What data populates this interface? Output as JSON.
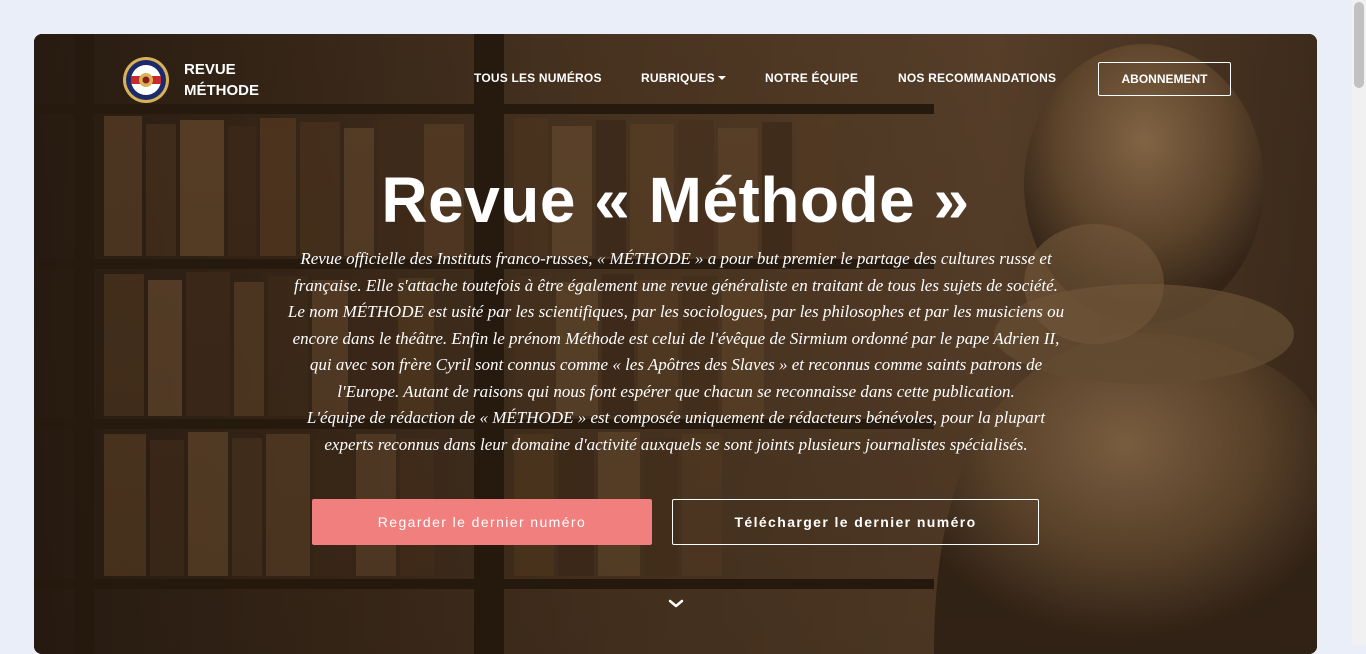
{
  "brand": {
    "name_line1": "REVUE",
    "name_line2": "MÉTHODE"
  },
  "nav": {
    "items": [
      {
        "label": "TOUS LES NUMÉROS"
      },
      {
        "label": "RUBRIQUES",
        "has_dropdown": true
      },
      {
        "label": "NOTRE ÉQUIPE"
      },
      {
        "label": "NOS RECOMMANDATIONS"
      }
    ],
    "subscribe_label": "ABONNEMENT"
  },
  "hero": {
    "title": "Revue « Méthode »",
    "description_lines": [
      "Revue officielle des Instituts franco-russes, « MÉTHODE » a pour but premier le partage des cultures russe et",
      "française. Elle s'attache toutefois à être également une revue généraliste en traitant de tous les sujets de société.",
      "Le nom MÉTHODE est usité par les scientifiques, par les sociologues, par les philosophes et par les musiciens ou",
      "encore dans le théâtre. Enfin le prénom Méthode est celui de l'évêque de Sirmium ordonné par le pape Adrien II,",
      "qui avec son frère Cyril sont connus comme « les Apôtres des Slaves » et reconnus comme saints patrons de",
      "l'Europe. Autant de raisons qui nous font espérer que chacun se reconnaisse dans cette publication.",
      "L'équipe de rédaction de « MÉTHODE » est composée uniquement de rédacteurs bénévoles, pour la plupart",
      "experts reconnus dans leur domaine d'activité auxquels se sont joints plusieurs journalistes spécialisés."
    ],
    "primary_button": "Regarder le dernier numéro",
    "secondary_button": "Télécharger le dernier numéro",
    "scroll_icon": "chevron-down-icon"
  },
  "colors": {
    "page_background": "#e9eef8",
    "primary_button": "#f07f7d",
    "hero_tint": "#6b4a2c"
  }
}
